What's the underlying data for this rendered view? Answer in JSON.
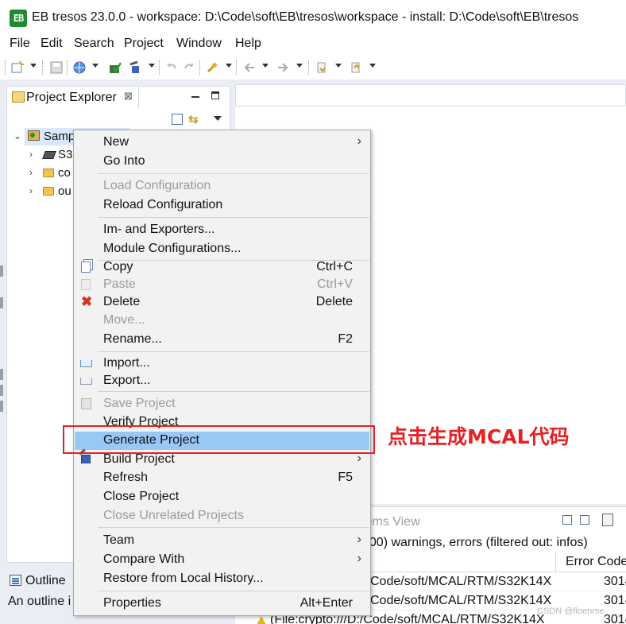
{
  "window": {
    "title": "EB tresos 23.0.0 - workspace: D:\\Code\\soft\\EB\\tresos\\workspace - install: D:\\Code\\soft\\EB\\tresos",
    "logo_text": "EB"
  },
  "menubar": [
    "File",
    "Edit",
    "Search",
    "Project",
    "Window",
    "Help"
  ],
  "toolbar": {
    "icons": [
      "new-icon",
      "save-icon",
      "globe-icon",
      "generate-icon",
      "build-icon",
      "undo-icon",
      "redo-icon",
      "pin-icon",
      "back-icon",
      "forward-icon",
      "next-annotation-icon",
      "prev-annotation-icon"
    ]
  },
  "project_explorer": {
    "tab_label": "Project Explorer",
    "close_glyph": "⊠",
    "tree": [
      {
        "label": "Samp",
        "icon": "project-icon",
        "expanded": true
      },
      {
        "label": "S3",
        "icon": "chip-icon"
      },
      {
        "label": "co",
        "icon": "folder-icon"
      },
      {
        "label": "ou",
        "icon": "folder-icon"
      }
    ]
  },
  "context_menu": {
    "items": {
      "new": {
        "label": "New",
        "submenu": "›"
      },
      "go_into": {
        "label": "Go Into"
      },
      "load_config": {
        "label": "Load Configuration"
      },
      "reload_config": {
        "label": "Reload Configuration"
      },
      "im_exporters": {
        "label": "Im- and Exporters..."
      },
      "module_configs": {
        "label": "Module Configurations..."
      },
      "copy": {
        "label": "Copy",
        "shortcut": "Ctrl+C"
      },
      "paste": {
        "label": "Paste",
        "shortcut": "Ctrl+V"
      },
      "delete": {
        "label": "Delete",
        "shortcut": "Delete",
        "glyph": "✖"
      },
      "move": {
        "label": "Move..."
      },
      "rename": {
        "label": "Rename...",
        "shortcut": "F2"
      },
      "import": {
        "label": "Import..."
      },
      "export": {
        "label": "Export..."
      },
      "save_project": {
        "label": "Save Project"
      },
      "verify_project": {
        "label": "Verify Project"
      },
      "generate_project": {
        "label": "Generate Project"
      },
      "build_project": {
        "label": "Build Project",
        "submenu": "›"
      },
      "refresh": {
        "label": "Refresh",
        "shortcut": "F5"
      },
      "close_project": {
        "label": "Close Project"
      },
      "close_unrelated": {
        "label": "Close Unrelated Projects"
      },
      "team": {
        "label": "Team",
        "submenu": "›"
      },
      "compare_with": {
        "label": "Compare With",
        "submenu": "›"
      },
      "restore_history": {
        "label": "Restore from Local History..."
      },
      "properties": {
        "label": "Properties",
        "shortcut": "Alt+Enter"
      }
    }
  },
  "annotation": {
    "text": "点击生成MCAL代码",
    "color": "#e42224"
  },
  "problems_view": {
    "tab_label": "lems View",
    "summary": "000) warnings, errors (filtered out: infos)",
    "error_code_header": "Error Code",
    "rows": [
      {
        "path": "Code/soft/MCAL/RTM/S32K14X",
        "code": "3014"
      },
      {
        "path": "Code/soft/MCAL/RTM/S32K14X",
        "code": "3014"
      },
      {
        "path": "(File:crypto:///D:/Code/soft/MCAL/RTM/S32K14X",
        "code": "3014"
      }
    ]
  },
  "outline": {
    "tab_label": "Outline",
    "message": "An outline i"
  },
  "watermark": "CSDN @floenrse"
}
